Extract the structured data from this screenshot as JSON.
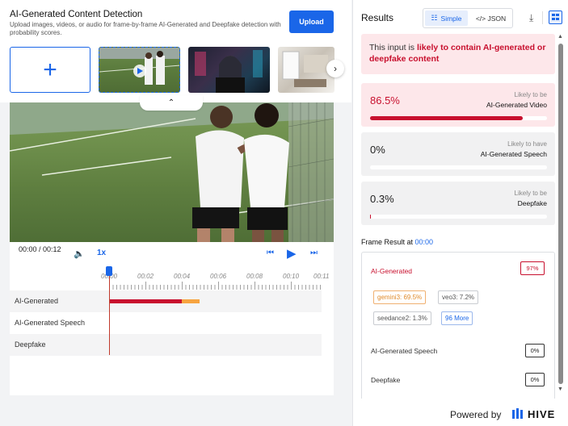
{
  "header": {
    "title": "AI-Generated Content Detection",
    "subtitle": "Upload images, videos, or audio for frame-by-frame AI-Generated and Deepfake detection with probability scores.",
    "upload_label": "Upload"
  },
  "player": {
    "time": "00:00 / 00:12",
    "speed": "1x"
  },
  "timeline": {
    "ticks": [
      "00:00",
      "00:02",
      "00:04",
      "00:06",
      "00:08",
      "00:10",
      "00:11"
    ],
    "playhead_label": "0",
    "rows": [
      {
        "label": "AI-Generated"
      },
      {
        "label": "AI-Generated Speech"
      },
      {
        "label": "Deepfake"
      }
    ]
  },
  "results": {
    "title": "Results",
    "view_simple": "Simple",
    "view_json": "</> JSON",
    "alert_prefix": "This input is ",
    "alert_strong": "likely to contain AI-generated or deepfake content",
    "cards": [
      {
        "pct": "86.5%",
        "line1": "Likely to be",
        "line2": "AI-Generated Video",
        "fill": 86.5
      },
      {
        "pct": "0%",
        "line1": "Likely to have",
        "line2": "AI-Generated Speech",
        "fill": 0
      },
      {
        "pct": "0.3%",
        "line1": "Likely to be",
        "line2": "Deepfake",
        "fill": 0.3
      }
    ],
    "frame_title": "Frame Result at ",
    "frame_time": "00:00",
    "frame": {
      "ai_label": "AI-Generated",
      "ai_pct": "97%",
      "chips": [
        "gemini3: 69.5%",
        "veo3: 7.2%",
        "seedance2: 1.3%",
        "96 More"
      ],
      "speech_label": "AI-Generated Speech",
      "speech_pct": "0%",
      "deepfake_label": "Deepfake",
      "deepfake_pct": "0%"
    }
  },
  "footer": {
    "powered": "Powered by",
    "brand": "HIVE"
  },
  "colors": {
    "accent": "#1a66e8",
    "danger": "#c8102e",
    "warning": "#f7a440"
  }
}
